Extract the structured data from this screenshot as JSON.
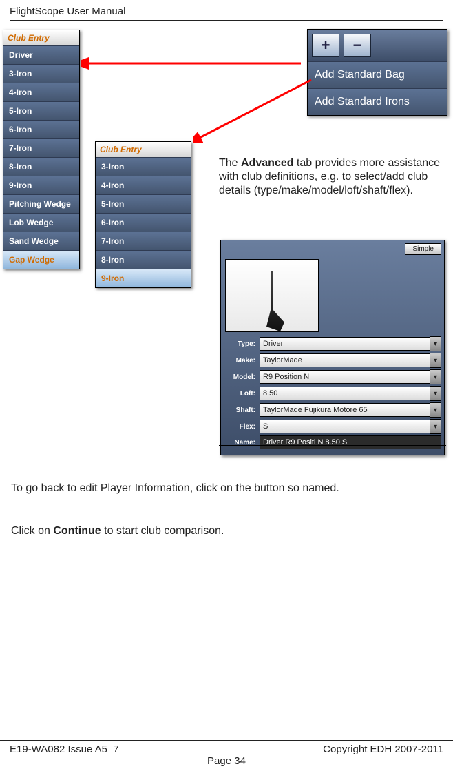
{
  "header": {
    "running": "FlightScope User Manual"
  },
  "clublist1": {
    "title": "Club Entry",
    "items": [
      "Driver",
      "3-Iron",
      "4-Iron",
      "5-Iron",
      "6-Iron",
      "7-Iron",
      "8-Iron",
      "9-Iron",
      "Pitching Wedge",
      "Lob Wedge",
      "Sand Wedge",
      "Gap Wedge"
    ],
    "selected_index": 11
  },
  "clublist2": {
    "title": "Club Entry",
    "items": [
      "3-Iron",
      "4-Iron",
      "5-Iron",
      "6-Iron",
      "7-Iron",
      "8-Iron",
      "9-Iron"
    ],
    "selected_index": 6
  },
  "addpanel": {
    "plus_icon": "+",
    "minus_icon": "−",
    "opt1": "Add Standard Bag",
    "opt2": "Add Standard Irons"
  },
  "adv_text": {
    "pre": "The ",
    "bold": "Advanced",
    "post": " tab provides more assistance with club definitions, e.g. to select/add club details (type/make/model/loft/shaft/flex)."
  },
  "adv_panel": {
    "mode_btn": "Simple",
    "rows": {
      "type": {
        "label": "Type:",
        "value": "Driver"
      },
      "make": {
        "label": "Make:",
        "value": "TaylorMade"
      },
      "model": {
        "label": "Model:",
        "value": "R9 Position N"
      },
      "loft": {
        "label": "Loft:",
        "value": "8.50"
      },
      "shaft": {
        "label": "Shaft:",
        "value": "TaylorMade Fujikura Motore 65"
      },
      "flex": {
        "label": "Flex:",
        "value": "S"
      },
      "name": {
        "label": "Name:",
        "value": "Driver R9 Positi N 8.50 S"
      }
    }
  },
  "body": {
    "line1": "To go back to edit Player Information, click on the button so named.",
    "line2_pre": "Click on ",
    "line2_bold": "Continue",
    "line2_post": " to start club comparison."
  },
  "footer": {
    "left": "E19-WA082 Issue A5_7",
    "right": "Copyright EDH 2007-2011",
    "page": "Page 34"
  }
}
